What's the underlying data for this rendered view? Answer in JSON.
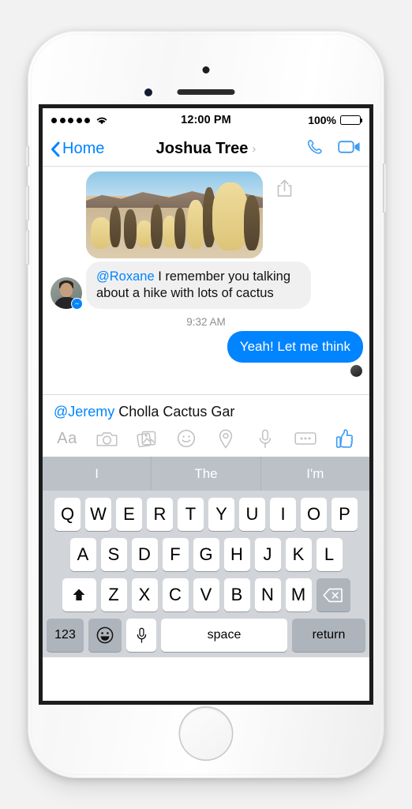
{
  "device": {
    "name": "iPhone",
    "color": "silver-white"
  },
  "status_bar": {
    "signal_dots": 5,
    "wifi_icon": "wifi-icon",
    "time": "12:00 PM",
    "battery_percent": "100%",
    "battery_level": 100
  },
  "nav_bar": {
    "back_label": "Home",
    "title": "Joshua Tree",
    "title_chevron": "›",
    "call_icon": "phone-call-icon",
    "video_icon": "video-call-icon"
  },
  "thread": {
    "photo_message": {
      "alt": "Cholla cactus garden photo",
      "share_icon": "share-icon"
    },
    "incoming_message": {
      "sender_avatar": "jeremy-avatar",
      "platform_badge": "messenger-badge",
      "mention": "@Roxane",
      "text": " I remember you talking about a hike with lots of cactus"
    },
    "timestamp": "9:32 AM",
    "outgoing_message": {
      "text": "Yeah! Let me think",
      "read_receipt_avatar": "read-receipt-avatar",
      "bubble_color": "#0084ff"
    }
  },
  "composer": {
    "mention": "@Jeremy",
    "text": " Cholla Cactus Gar",
    "tools": [
      {
        "name": "text-format-icon",
        "label": "Aa"
      },
      {
        "name": "camera-icon",
        "label": ""
      },
      {
        "name": "photo-library-icon",
        "label": ""
      },
      {
        "name": "sticker-smiley-icon",
        "label": ""
      },
      {
        "name": "location-pin-icon",
        "label": ""
      },
      {
        "name": "microphone-icon",
        "label": ""
      },
      {
        "name": "more-options-icon",
        "label": ""
      },
      {
        "name": "thumbs-up-icon",
        "label": ""
      }
    ]
  },
  "keyboard": {
    "predictions": [
      "I",
      "The",
      "I'm"
    ],
    "row1": [
      "Q",
      "W",
      "E",
      "R",
      "T",
      "Y",
      "U",
      "I",
      "O",
      "P"
    ],
    "row2": [
      "A",
      "S",
      "D",
      "F",
      "G",
      "H",
      "J",
      "K",
      "L"
    ],
    "row3": [
      "Z",
      "X",
      "C",
      "V",
      "B",
      "N",
      "M"
    ],
    "shift_key": "shift-key",
    "backspace_key": "backspace-key",
    "numeric_key": "123",
    "emoji_key": "emoji-key",
    "dictation_key": "dictation-key",
    "space_key": "space",
    "return_key": "return"
  },
  "colors": {
    "accent_blue": "#0084ff",
    "bubble_gray": "#f1f0f0",
    "keyboard_bg": "#d1d5da",
    "key_gray": "#aeb4bc"
  }
}
